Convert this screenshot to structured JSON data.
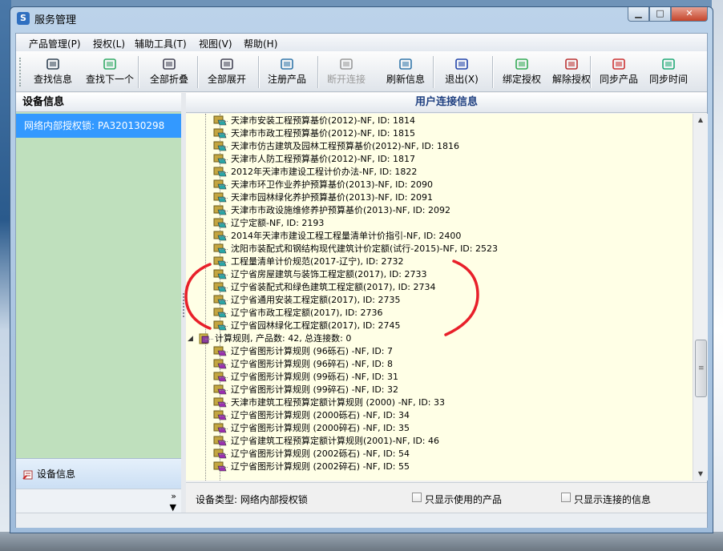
{
  "window": {
    "title": "服务管理"
  },
  "menu": [
    "产品管理(P)",
    "授权(L)",
    "辅助工具(T)",
    "视图(V)",
    "帮助(H)"
  ],
  "toolbar": [
    {
      "label": "查找信息",
      "icon": "binoculars-icon",
      "disabled": false
    },
    {
      "label": "查找下一个",
      "icon": "find-next-icon",
      "disabled": false
    },
    {
      "label": "全部折叠",
      "icon": "collapse-all-icon",
      "disabled": false
    },
    {
      "label": "全部展开",
      "icon": "expand-all-icon",
      "disabled": false
    },
    {
      "label": "注册产品",
      "icon": "register-product-icon",
      "disabled": false
    },
    {
      "label": "断开连接",
      "icon": "disconnect-icon",
      "disabled": true
    },
    {
      "label": "刷新信息",
      "icon": "refresh-icon",
      "disabled": false
    },
    {
      "label": "退出(X)",
      "icon": "exit-icon",
      "disabled": false
    },
    {
      "label": "绑定授权",
      "icon": "bind-license-icon",
      "disabled": false
    },
    {
      "label": "解除授权",
      "icon": "unbind-license-icon",
      "disabled": false
    },
    {
      "label": "同步产品",
      "icon": "sync-product-icon",
      "disabled": false
    },
    {
      "label": "同步时间",
      "icon": "sync-time-icon",
      "disabled": false
    }
  ],
  "left_panel": {
    "header": "设备信息",
    "selected_item": "网络内部授权锁: PA320130298",
    "bottom_tab": "设备信息",
    "chevron": "»"
  },
  "right_panel": {
    "header": "用户连接信息",
    "tree_rows": [
      {
        "text": "天津市安装工程预算基价(2012)-NF, ID: 1814",
        "level": 2
      },
      {
        "text": "天津市市政工程预算基价(2012)-NF, ID: 1815",
        "level": 2
      },
      {
        "text": "天津市仿古建筑及园林工程预算基价(2012)-NF, ID: 1816",
        "level": 2
      },
      {
        "text": "天津市人防工程预算基价(2012)-NF, ID: 1817",
        "level": 2
      },
      {
        "text": "2012年天津市建设工程计价办法-NF, ID: 1822",
        "level": 2
      },
      {
        "text": "天津市环卫作业养护预算基价(2013)-NF, ID: 2090",
        "level": 2
      },
      {
        "text": "天津市园林绿化养护预算基价(2013)-NF, ID: 2091",
        "level": 2
      },
      {
        "text": "天津市市政设施维修养护预算基价(2013)-NF, ID: 2092",
        "level": 2
      },
      {
        "text": "辽宁定额-NF, ID: 2193",
        "level": 2
      },
      {
        "text": "2014年天津市建设工程工程量清单计价指引-NF, ID: 2400",
        "level": 2
      },
      {
        "text": "沈阳市装配式和钢结构现代建筑计价定额(试行-2015)-NF, ID: 2523",
        "level": 2
      },
      {
        "text": "工程量清单计价规范(2017-辽宁), ID: 2732",
        "level": 2
      },
      {
        "text": "辽宁省房屋建筑与装饰工程定额(2017), ID: 2733",
        "level": 2
      },
      {
        "text": "辽宁省装配式和绿色建筑工程定额(2017), ID: 2734",
        "level": 2
      },
      {
        "text": "辽宁省通用安装工程定额(2017), ID: 2735",
        "level": 2
      },
      {
        "text": "辽宁省市政工程定额(2017), ID: 2736",
        "level": 2
      },
      {
        "text": "辽宁省园林绿化工程定额(2017), ID: 2745",
        "level": 2
      },
      {
        "text": "计算规则, 产品数: 42, 总连接数: 0",
        "level": 1
      },
      {
        "text": "辽宁省图形计算规则 (96砾石) -NF, ID: 7",
        "level": 2
      },
      {
        "text": "辽宁省图形计算规则 (96碎石) -NF, ID: 8",
        "level": 2
      },
      {
        "text": "辽宁省图形计算规则 (99砾石) -NF, ID: 31",
        "level": 2
      },
      {
        "text": "辽宁省图形计算规则 (99碎石) -NF, ID: 32",
        "level": 2
      },
      {
        "text": "天津市建筑工程预算定额计算规则 (2000) -NF, ID: 33",
        "level": 2
      },
      {
        "text": "辽宁省图形计算规则 (2000砾石) -NF, ID: 34",
        "level": 2
      },
      {
        "text": "辽宁省图形计算规则 (2000碎石) -NF, ID: 35",
        "level": 2
      },
      {
        "text": "辽宁省建筑工程预算定额计算规则(2001)-NF, ID: 46",
        "level": 2
      },
      {
        "text": "辽宁省图形计算规则 (2002砾石) -NF, ID: 54",
        "level": 2
      },
      {
        "text": "辽宁省图形计算规则 (2002碎石) -NF, ID: 55",
        "level": 2
      }
    ],
    "device_type": "设备类型: 网络内部授权锁",
    "checkbox_used": "只显示使用的产品",
    "checkbox_connected": "只显示连接的信息"
  },
  "colors": {
    "annotation": "#e8202a",
    "selection": "#3399ff",
    "tree_bg": "#ffffe6",
    "left_bg": "#bfe0bd"
  }
}
